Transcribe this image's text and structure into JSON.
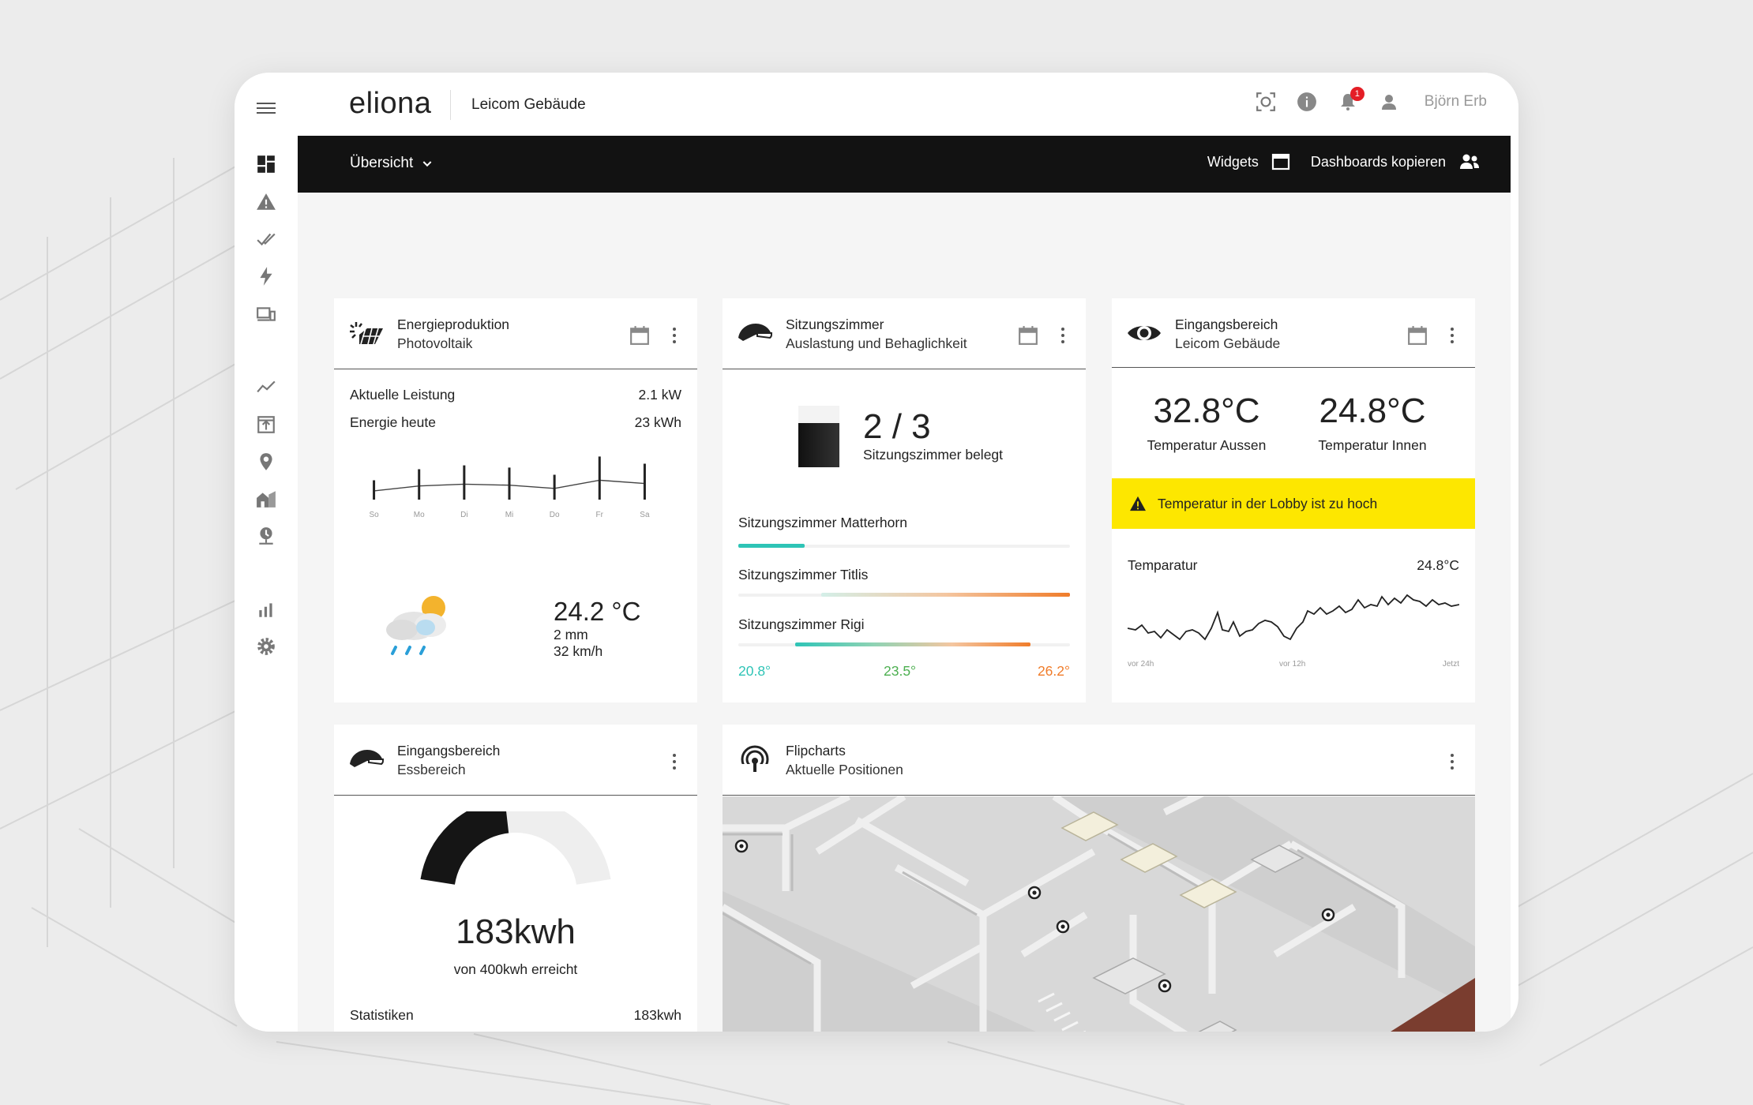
{
  "topbar": {
    "logo": "eliona",
    "building": "Leicom Gebäude",
    "notification_count": "1",
    "user": "Björn Erb"
  },
  "navbar": {
    "dashboard_select": "Übersicht",
    "widgets_label": "Widgets",
    "copy_label": "Dashboards kopieren"
  },
  "energy": {
    "title": "Energieproduktion",
    "subtitle": "Photovoltaik",
    "power_label": "Aktuelle Leistung",
    "power_value": "2.1 kW",
    "today_label": "Energie heute",
    "today_value": "23 kWh",
    "days": [
      "So",
      "Mo",
      "Di",
      "Mi",
      "Do",
      "Fr",
      "Sa"
    ],
    "day_levels": [
      0.35,
      0.55,
      0.62,
      0.58,
      0.45,
      0.78,
      0.65
    ],
    "weather_temp": "24.2 °C",
    "weather_rain": "2 mm",
    "weather_wind": "32 km/h"
  },
  "rooms": {
    "title": "Sitzungszimmer",
    "subtitle": "Auslastung und Behaglichkeit",
    "occupancy": "2 / 3",
    "occupancy_label": "Sitzungszimmer belegt",
    "items": [
      {
        "name": "Sitzungszimmer Matterhorn",
        "fill": 0.2
      },
      {
        "name": "Sitzungszimmer Titlis",
        "fill": 1.0
      },
      {
        "name": "Sitzungszimmer Rigi",
        "fill": 0.88
      }
    ],
    "scale": [
      "20.8°",
      "23.5°",
      "26.2°"
    ]
  },
  "entrance": {
    "title": "Eingangsbereich",
    "subtitle": "Leicom Gebäude",
    "temp_out": "32.8°C",
    "temp_out_label": "Temperatur Aussen",
    "temp_in": "24.8°C",
    "temp_in_label": "Temperatur Innen",
    "alert": "Temperatur in der Lobby ist zu hoch",
    "chart_label": "Temparatur",
    "chart_value": "24.8°C",
    "axis": [
      "vor 24h",
      "vor 12h",
      "Jetzt"
    ]
  },
  "dining": {
    "title": "Eingangsbereich",
    "subtitle": "Essbereich",
    "value": "183kwh",
    "caption": "von 400kwh erreicht",
    "progress": 0.46,
    "stats_label": "Statistiken",
    "stats_value": "183kwh"
  },
  "flipcharts": {
    "title": "Flipcharts",
    "subtitle": "Aktuelle Positionen"
  },
  "colors": {
    "accent_teal": "#2ec4b6",
    "accent_orange": "#f07c2a",
    "alert_yellow": "#fde700",
    "navbar_black": "#121212"
  }
}
